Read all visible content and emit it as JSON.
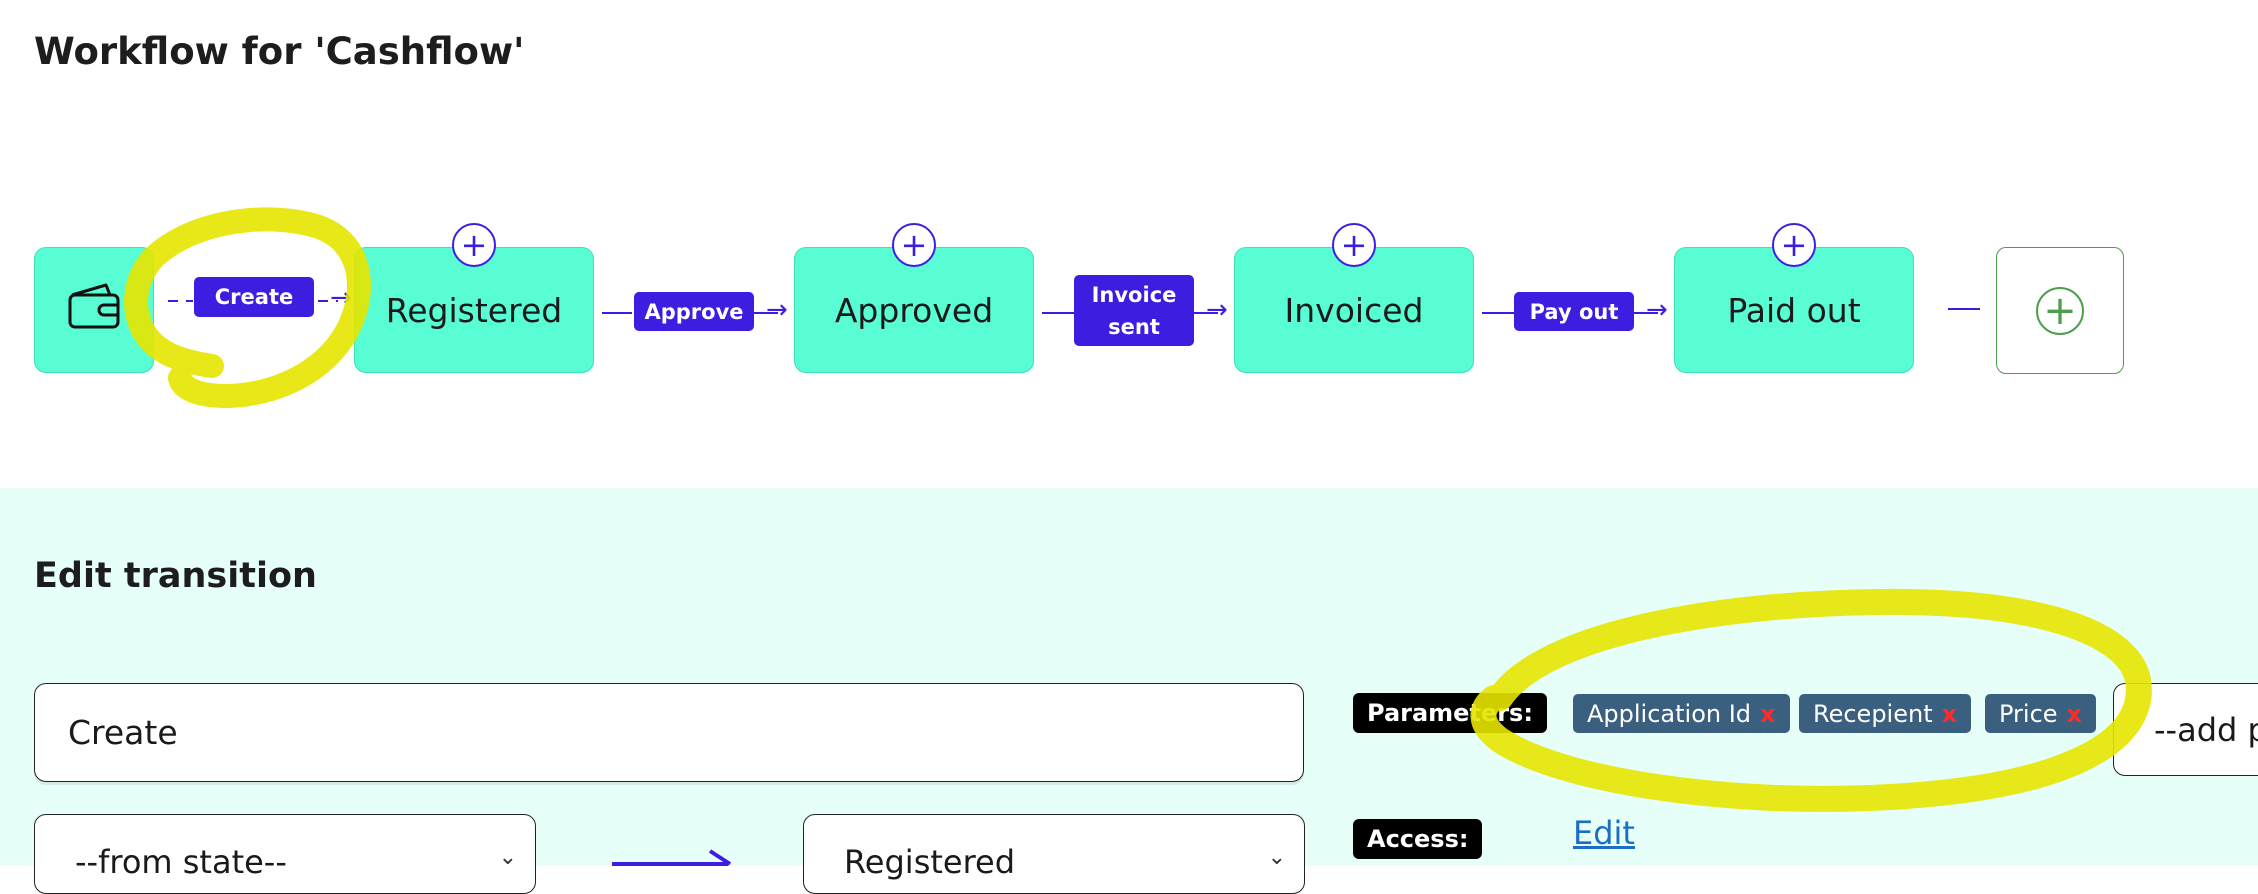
{
  "workflow": {
    "title": "Workflow for 'Cashflow'",
    "start_icon": "wallet-icon",
    "states": [
      {
        "label": "Registered"
      },
      {
        "label": "Approved"
      },
      {
        "label": "Invoiced"
      },
      {
        "label": "Paid out"
      }
    ],
    "transitions": [
      {
        "label": "Create"
      },
      {
        "label": "Approve"
      },
      {
        "label": "Invoice sent"
      },
      {
        "label": "Pay out"
      }
    ],
    "add_state_icon": "plus-circle-icon",
    "add_transition_icon": "plus-icon"
  },
  "edit_transition": {
    "title": "Edit transition",
    "name_value": "Create",
    "from_state": "--from state--",
    "to_state": "Registered",
    "parameters_label": "Parameters:",
    "parameters": [
      {
        "label": "Application Id",
        "remove": "x"
      },
      {
        "label": "Recepient",
        "remove": "x"
      },
      {
        "label": "Price",
        "remove": "x"
      }
    ],
    "add_parameter_placeholder": "--add parameter--",
    "access_label": "Access:",
    "access_edit_link": "Edit"
  },
  "colors": {
    "state_fill": "#58fdd3",
    "accent": "#3d1ee0",
    "panel_bg": "#e6fff9",
    "chip_bg": "#3a5f7f",
    "highlight": "#e8e600",
    "add_state_green": "#4f9d4f"
  }
}
